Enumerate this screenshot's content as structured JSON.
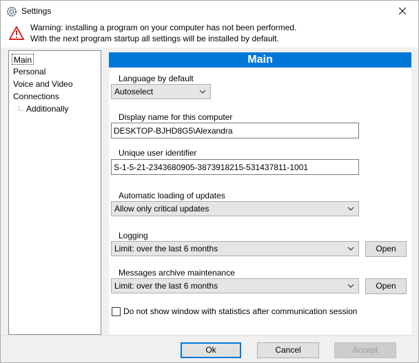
{
  "window": {
    "title": "Settings"
  },
  "warning": {
    "line1": "Warning: installing a program on your computer has not been performed.",
    "line2": "With the next program startup all settings will be installed by default."
  },
  "tree": {
    "items": [
      {
        "label": "Main",
        "selected": true
      },
      {
        "label": "Personal"
      },
      {
        "label": "Voice and Video"
      },
      {
        "label": "Connections"
      },
      {
        "label": "Additionally"
      }
    ]
  },
  "main": {
    "header": "Main",
    "language_label": "Language by default",
    "language_value": "Autoselect",
    "display_name_label": "Display name for this computer",
    "display_name_value": "DESKTOP-BJHD8G5\\Alexandra",
    "uid_label": "Unique user identifier",
    "uid_value": "S-1-5-21-2343680905-3873918215-531437811-1001",
    "updates_label": "Automatic loading of updates",
    "updates_value": "Allow only critical updates",
    "logging_label": "Logging",
    "logging_value": "Limit: over the last 6 months",
    "logging_open": "Open",
    "archive_label": "Messages archive maintenance",
    "archive_value": "Limit: over the last 6 months",
    "archive_open": "Open",
    "stats_checkbox_label": "Do not show window with statistics after communication session"
  },
  "footer": {
    "ok": "Ok",
    "cancel": "Cancel",
    "accept": "Accept"
  },
  "colors": {
    "accent": "#0078d7",
    "warning_red": "#d9262c"
  }
}
